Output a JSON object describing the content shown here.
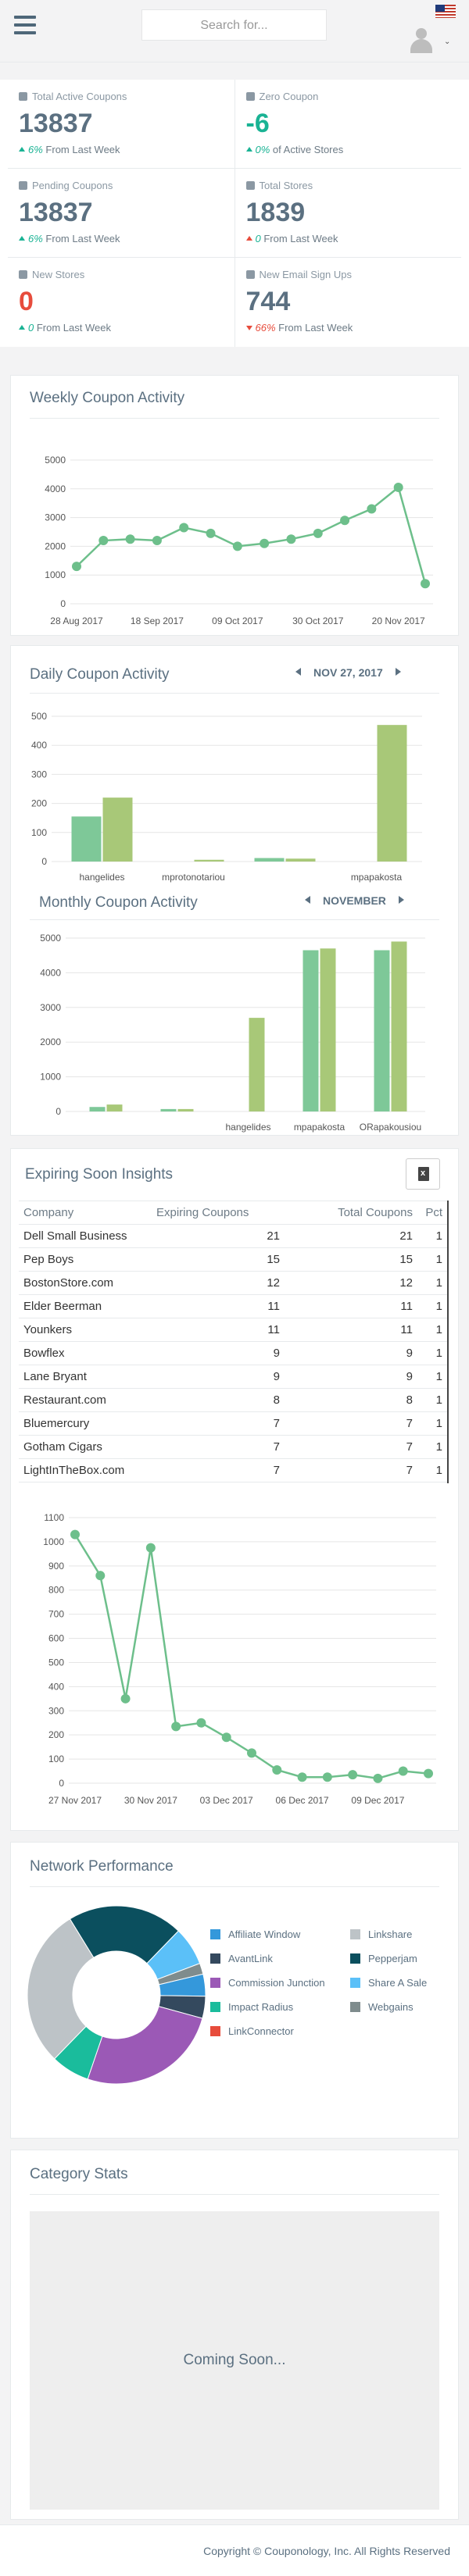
{
  "header": {
    "search_placeholder": "Search for...",
    "menu_icon": "hamburger-icon",
    "flag_icon": "us-flag-icon",
    "avatar_icon": "user-avatar-icon"
  },
  "stats": [
    {
      "label": "Total Active Coupons",
      "icon": "tag-icon",
      "value": "13837",
      "value_color": "default",
      "trend": "up",
      "pct": "6%",
      "suffix": "From Last Week"
    },
    {
      "label": "Zero Coupon",
      "icon": "ban-icon",
      "value": "-6",
      "value_color": "teal",
      "trend": "up",
      "pct": "0%",
      "suffix": "of Active Stores"
    },
    {
      "label": "Pending Coupons",
      "icon": "tag-icon",
      "value": "13837",
      "value_color": "default",
      "trend": "up",
      "pct": "6%",
      "suffix": "From Last Week"
    },
    {
      "label": "Total Stores",
      "icon": "building-icon",
      "value": "1839",
      "value_color": "default",
      "trend": "up-red",
      "pct": "0",
      "suffix": "From Last Week"
    },
    {
      "label": "New Stores",
      "icon": "building-icon",
      "value": "0",
      "value_color": "red",
      "trend": "up",
      "pct": "0",
      "suffix": "From Last Week"
    },
    {
      "label": "New Email Sign Ups",
      "icon": "eye-icon",
      "value": "744",
      "value_color": "default",
      "trend": "down",
      "pct": "66%",
      "suffix": "From Last Week"
    }
  ],
  "weekly": {
    "title": "Weekly Coupon Activity"
  },
  "daily": {
    "title": "Daily Coupon Activity",
    "date": "NOV 27, 2017",
    "monthly_title": "Monthly Coupon Activity",
    "month": "NOVEMBER"
  },
  "expiring": {
    "title": "Expiring Soon Insights",
    "export_icon": "excel-export-icon",
    "columns": [
      "Company",
      "Expiring Coupons",
      "Total Coupons",
      "Pct"
    ],
    "rows": [
      [
        "Dell Small Business",
        "21",
        "21",
        "1"
      ],
      [
        "Pep Boys",
        "15",
        "15",
        "1"
      ],
      [
        "BostonStore.com",
        "12",
        "12",
        "1"
      ],
      [
        "Elder Beerman",
        "11",
        "11",
        "1"
      ],
      [
        "Younkers",
        "11",
        "11",
        "1"
      ],
      [
        "Bowflex",
        "9",
        "9",
        "1"
      ],
      [
        "Lane Bryant",
        "9",
        "9",
        "1"
      ],
      [
        "Restaurant.com",
        "8",
        "8",
        "1"
      ],
      [
        "Bluemercury",
        "7",
        "7",
        "1"
      ],
      [
        "Gotham Cigars",
        "7",
        "7",
        "1"
      ],
      [
        "LightInTheBox.com",
        "7",
        "7",
        "1"
      ]
    ]
  },
  "network": {
    "title": "Network Performance",
    "legend": [
      {
        "label": "Affiliate Window",
        "color": "#3498db"
      },
      {
        "label": "Linkshare",
        "color": "#bdc3c7"
      },
      {
        "label": "AvantLink",
        "color": "#34495e"
      },
      {
        "label": "Pepperjam",
        "color": "#0b4f5e"
      },
      {
        "label": "Commission Junction",
        "color": "#9b59b6"
      },
      {
        "label": "Share A Sale",
        "color": "#5bc0f8"
      },
      {
        "label": "Impact Radius",
        "color": "#1abc9c"
      },
      {
        "label": "Webgains",
        "color": "#7f8c8d"
      },
      {
        "label": "LinkConnector",
        "color": "#e74c3c"
      }
    ]
  },
  "category": {
    "title": "Category Stats",
    "placeholder": "Coming Soon..."
  },
  "footer": {
    "text": "Copyright © Couponology, Inc. All Rights Reserved"
  },
  "chart_data": [
    {
      "type": "line",
      "x": [
        "28 Aug 2017",
        "04 Sep 2017",
        "11 Sep 2017",
        "18 Sep 2017",
        "25 Sep 2017",
        "02 Oct 2017",
        "09 Oct 2017",
        "16 Oct 2017",
        "23 Oct 2017",
        "30 Oct 2017",
        "06 Nov 2017",
        "13 Nov 2017",
        "20 Nov 2017",
        "27 Nov 2017"
      ],
      "xticks": [
        "28 Aug 2017",
        "18 Sep 2017",
        "09 Oct 2017",
        "30 Oct 2017",
        "20 Nov 2017"
      ],
      "values": [
        1300,
        2200,
        2250,
        2200,
        2650,
        2450,
        2000,
        2100,
        2250,
        2450,
        2900,
        3300,
        4050,
        700
      ],
      "ylim": [
        0,
        5000
      ],
      "yticks": [
        0,
        1000,
        2000,
        3000,
        4000,
        5000
      ],
      "color": "#6dbf8b"
    },
    {
      "type": "bar",
      "categories": [
        "hangelides",
        "mprotonotariou",
        "",
        "mpapakosta"
      ],
      "xticks": [
        "hangelides",
        "mprotonotariou",
        "mpapakosta"
      ],
      "series": [
        {
          "color": "#7ec898",
          "values": [
            155,
            0,
            12,
            0
          ]
        },
        {
          "color": "#a8c878",
          "values": [
            220,
            6,
            10,
            470
          ]
        }
      ],
      "ylim": [
        0,
        500
      ],
      "yticks": [
        0,
        100,
        200,
        300,
        400,
        500
      ]
    },
    {
      "type": "bar",
      "categories": [
        "",
        "",
        "hangelides",
        "mpapakosta",
        "ORapakousiou"
      ],
      "xticks": [
        "hangelides",
        "mpapakosta",
        "ORapakousiou"
      ],
      "series": [
        {
          "color": "#7ec898",
          "values": [
            130,
            70,
            0,
            4650,
            4650
          ]
        },
        {
          "color": "#a8c878",
          "values": [
            200,
            70,
            2700,
            4700,
            4900
          ]
        }
      ],
      "ylim": [
        0,
        5000
      ],
      "yticks": [
        0,
        1000,
        2000,
        3000,
        4000,
        5000
      ]
    },
    {
      "type": "line",
      "x": [
        "27 Nov 2017",
        "28 Nov 2017",
        "29 Nov 2017",
        "30 Nov 2017",
        "01 Dec 2017",
        "02 Dec 2017",
        "03 Dec 2017",
        "04 Dec 2017",
        "05 Dec 2017",
        "06 Dec 2017",
        "07 Dec 2017",
        "08 Dec 2017",
        "09 Dec 2017",
        "10 Dec 2017",
        "11 Dec 2017"
      ],
      "xticks": [
        "27 Nov 2017",
        "30 Nov 2017",
        "03 Dec 2017",
        "06 Dec 2017",
        "09 Dec 2017"
      ],
      "values": [
        1030,
        860,
        350,
        975,
        235,
        250,
        190,
        125,
        55,
        25,
        25,
        35,
        20,
        50,
        40
      ],
      "ylim": [
        0,
        1100
      ],
      "yticks": [
        0,
        100,
        200,
        300,
        400,
        500,
        600,
        700,
        800,
        900,
        1000,
        1100
      ],
      "color": "#6dbf8b"
    },
    {
      "type": "pie",
      "labels": [
        "Pepperjam",
        "Share A Sale",
        "Webgains",
        "Affiliate Window",
        "AvantLink",
        "Commission Junction",
        "Impact Radius",
        "LinkConnector",
        "Linkshare"
      ],
      "values": [
        21,
        7,
        2,
        4,
        4,
        26,
        7,
        0,
        29
      ],
      "colors": [
        "#0b4f5e",
        "#5bc0f8",
        "#7f8c8d",
        "#3498db",
        "#34495e",
        "#9b59b6",
        "#1abc9c",
        "#e74c3c",
        "#bdc3c7"
      ]
    }
  ]
}
